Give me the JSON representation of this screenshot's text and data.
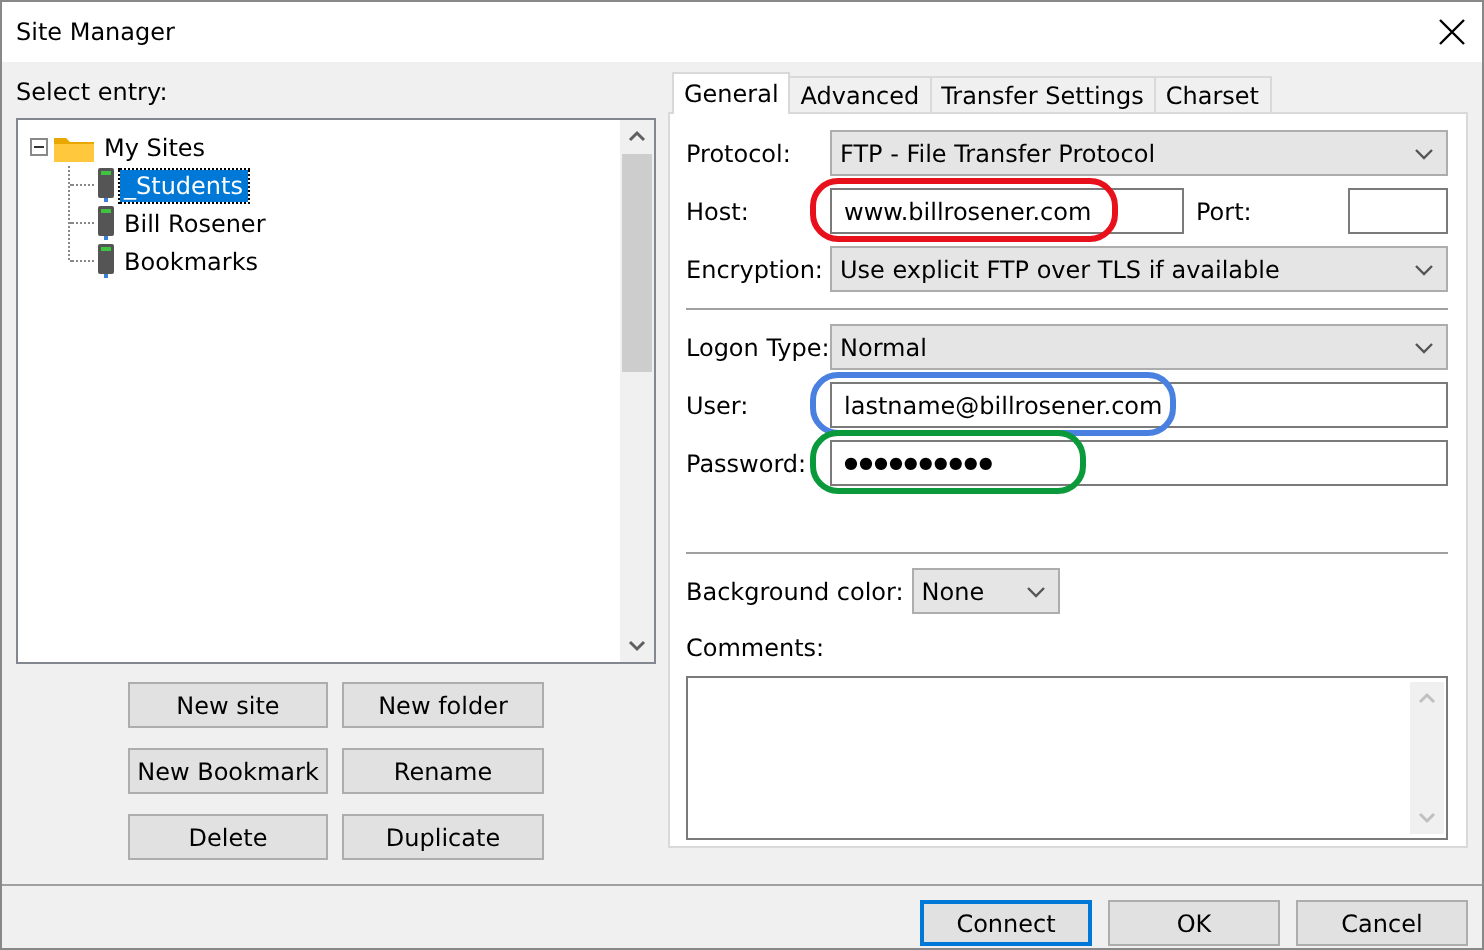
{
  "window": {
    "title": "Site Manager"
  },
  "tree": {
    "label": "Select entry:",
    "items": [
      {
        "label": "My Sites",
        "kind": "folder",
        "expanded": true,
        "selected": false,
        "children": [
          {
            "label": "_Students",
            "kind": "site",
            "selected": true
          },
          {
            "label": "Bill Rosener",
            "kind": "site",
            "selected": false
          },
          {
            "label": "Bookmarks",
            "kind": "site",
            "selected": false
          }
        ]
      }
    ]
  },
  "site_buttons": [
    "New site",
    "New folder",
    "New Bookmark",
    "Rename",
    "Delete",
    "Duplicate"
  ],
  "tabs": [
    {
      "label": "General",
      "selected": true
    },
    {
      "label": "Advanced",
      "selected": false
    },
    {
      "label": "Transfer Settings",
      "selected": false
    },
    {
      "label": "Charset",
      "selected": false
    }
  ],
  "general": {
    "protocol": {
      "label": "Protocol:",
      "value": "FTP - File Transfer Protocol"
    },
    "host": {
      "label": "Host:",
      "value": "www.billrosener.com",
      "highlight": {
        "color": "#e8101a"
      }
    },
    "port": {
      "label": "Port:"
    },
    "encryption": {
      "label": "Encryption:",
      "value": "Use explicit FTP over TLS if available"
    },
    "logon_type": {
      "label": "Logon Type:",
      "value": "Normal"
    },
    "user": {
      "label": "User:",
      "value": "lastname@billrosener.com",
      "highlight": {
        "color": "#4a80e0"
      }
    },
    "password": {
      "label": "Password:",
      "value": "●●●●●●●●●●",
      "highlight": {
        "color": "#0a9a3c"
      }
    },
    "background_color": {
      "label": "Background color:",
      "value": "None"
    },
    "comments": {
      "label": "Comments:"
    }
  },
  "footer_buttons": [
    {
      "label": "Connect",
      "default": true
    },
    {
      "label": "OK",
      "default": false
    },
    {
      "label": "Cancel",
      "default": false
    }
  ]
}
